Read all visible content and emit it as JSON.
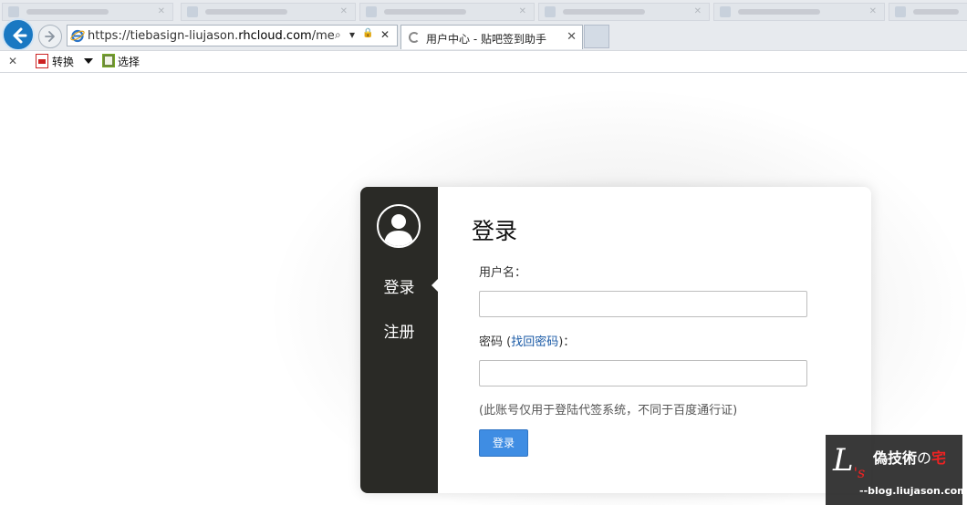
{
  "browser": {
    "url_prefix": "https://tiebasign-liujason.",
    "url_domain": "rhcloud.com",
    "url_suffix": "/membe",
    "active_tab_title": "用户中心 - 贴吧签到助手",
    "tab_close": "✕",
    "addr_tools": {
      "search": "⌕",
      "dropdown": "▾",
      "lock": "🔒",
      "stop": "✕"
    }
  },
  "command_bar": {
    "close": "✕",
    "convert_label": "转换",
    "select_label": "选择"
  },
  "sidebar": {
    "items": [
      {
        "label": "登录",
        "active": true
      },
      {
        "label": "注册",
        "active": false
      }
    ]
  },
  "form": {
    "title": "登录",
    "username_label": "用户名：",
    "username_value": "",
    "password_label_prefix": "密码 (",
    "password_link": "找回密码",
    "password_label_suffix": ")：",
    "password_value": "",
    "note": "(此账号仅用于登陆代签系统，不同于百度通行证)",
    "submit_label": "登录"
  },
  "watermark": {
    "logo_main": "L",
    "logo_sub": "'s",
    "title_part1": "偽技術",
    "title_part2": "の",
    "title_part3": "宅",
    "site": "--blog.liujason.com"
  },
  "colors": {
    "sidebar_bg": "#2a2a26",
    "button_bg": "#3f8de3",
    "link": "#1a5aa6",
    "browser_back": "#1a78c2"
  }
}
